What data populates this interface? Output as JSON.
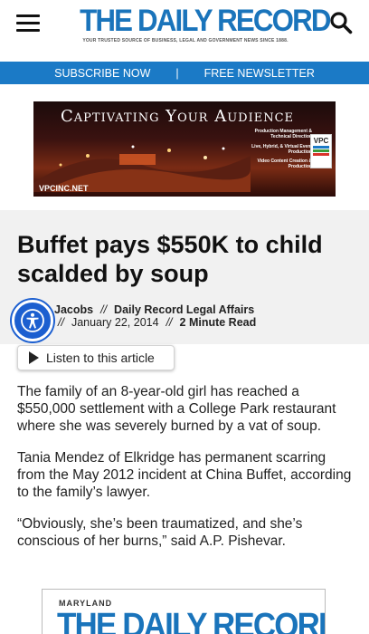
{
  "header": {
    "logo_title": "THE DAILY RECORD",
    "logo_tagline": "YOUR TRUSTED SOURCE OF BUSINESS, LEGAL AND GOVERNMENT NEWS SINCE 1888.",
    "menu_icon": "hamburger-icon",
    "search_icon": "search-icon",
    "brand_color": "#1a74bb"
  },
  "promo_bar": {
    "subscribe": "SUBSCRIBE NOW",
    "separator": "|",
    "newsletter": "FREE NEWSLETTER",
    "color": "#1b7ac6"
  },
  "ad": {
    "title": "Captivating Your Audience",
    "services": [
      "Production Management & Technical Direction",
      "Live, Hybrid, & Virtual Event Production",
      "Video Content Creation & Production"
    ],
    "logo": "VPC",
    "url": "VPCINC.NET"
  },
  "article": {
    "headline": "Buffet pays $550K to child scalded by soup",
    "author": "Jacobs",
    "byline_sep": "//",
    "section": "Daily Record Legal Affairs",
    "date": "January 22, 2014",
    "read_time": "2 Minute Read",
    "listen_label": "Listen to this article",
    "paragraphs": [
      "The family of an 8-year-old girl has reached a $550,000 settlement with a College Park restaurant where she was severely burned by a vat of soup.",
      "Tania Mendez of Elkridge has permanent scarring from the May 2012 incident at China Buffet, according to the family’s lawyer.",
      "“Obviously, she’s been traumatized, and she’s conscious of her burns,” said A.P. Pishevar."
    ]
  },
  "accessibility": {
    "icon": "accessibility-icon",
    "color": "#1c5fd0"
  },
  "bottom_ad": {
    "kicker": "MARYLAND",
    "title": "THE DAILY RECORD"
  }
}
